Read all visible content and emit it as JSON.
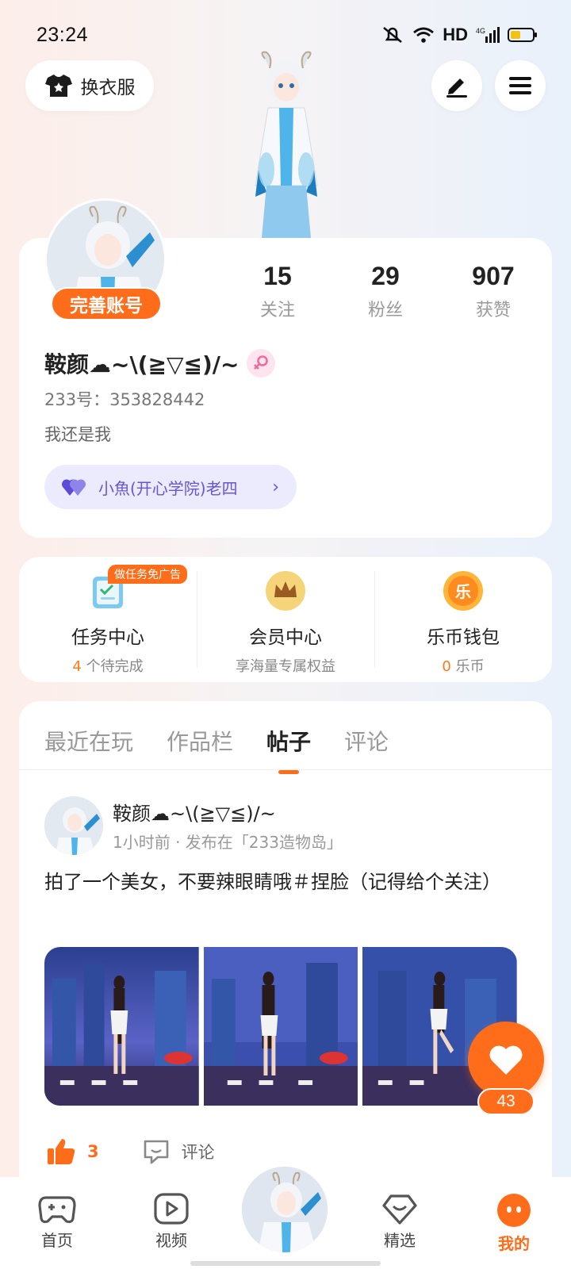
{
  "status_bar": {
    "time": "23:24",
    "hd": "HD",
    "network": "4G"
  },
  "header": {
    "dress_label": "换衣服"
  },
  "profile": {
    "badge": "完善账号",
    "stats": [
      {
        "value": "15",
        "label": "关注"
      },
      {
        "value": "29",
        "label": "粉丝"
      },
      {
        "value": "907",
        "label": "获赞"
      }
    ],
    "nickname": "鞍颜☁~\\(≧▽≦)/~",
    "uid": "233号：353828442",
    "signature": "我还是我",
    "cp_label": "小魚(开心学院)老四"
  },
  "functions": [
    {
      "title": "任务中心",
      "count": "4",
      "sub_suffix": " 个待完成",
      "tag": "做任务免广告"
    },
    {
      "title": "会员中心",
      "sub": "享海量专属权益"
    },
    {
      "title": "乐币钱包",
      "count": "0",
      "sub_suffix": " 乐币",
      "icon_char": "乐"
    }
  ],
  "tabs": [
    "最近在玩",
    "作品栏",
    "帖子",
    "评论"
  ],
  "active_tab": "帖子",
  "post": {
    "author": "鞍颜☁~\\(≧▽≦)/~",
    "meta": "1小时前 · 发布在「233造物岛」",
    "text": "拍了一个美女，不要辣眼睛哦＃捏脸（记得给个关注）",
    "like_count": "3",
    "comment_label": "评论"
  },
  "floating_favorite": {
    "count": "43"
  },
  "bottom_nav": [
    {
      "label": "首页",
      "icon": "gamepad-icon"
    },
    {
      "label": "视频",
      "icon": "play-icon"
    },
    {
      "label": "精选",
      "icon": "heart-diamond-icon"
    },
    {
      "label": "我的",
      "icon": "face-icon",
      "active": true
    }
  ],
  "colors": {
    "accent": "#ff6d1b",
    "cp_purple": "#6656d8"
  }
}
